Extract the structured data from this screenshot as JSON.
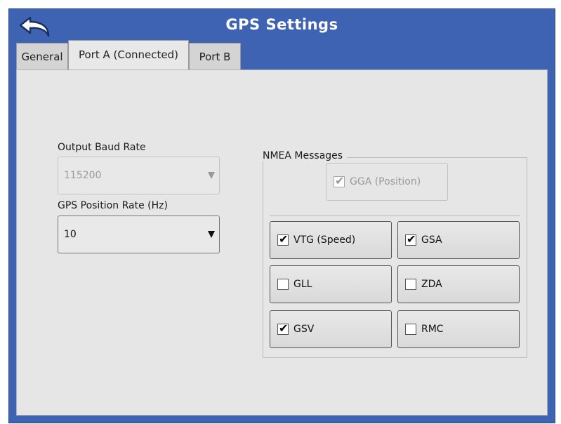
{
  "header": {
    "title": "GPS Settings",
    "back_icon": "back-arrow-icon"
  },
  "tabs": [
    {
      "label": "General",
      "active": false
    },
    {
      "label": "Port A (Connected)",
      "active": true
    },
    {
      "label": "Port B",
      "active": false
    }
  ],
  "baud": {
    "label": "Output Baud Rate",
    "value": "115200",
    "enabled": false
  },
  "position_rate": {
    "label": "GPS Position Rate (Hz)",
    "value": "10",
    "enabled": true
  },
  "nmea": {
    "legend": "NMEA Messages",
    "gga": {
      "label": "GGA (Position)",
      "checked": true,
      "enabled": false
    },
    "messages": [
      {
        "label": "VTG (Speed)",
        "checked": true
      },
      {
        "label": "GSA",
        "checked": true
      },
      {
        "label": "GLL",
        "checked": false
      },
      {
        "label": "ZDA",
        "checked": false
      },
      {
        "label": "GSV",
        "checked": true
      },
      {
        "label": "RMC",
        "checked": false
      }
    ]
  },
  "colors": {
    "header_blue": "#3f63b3",
    "panel_gray": "#e6e6e6"
  }
}
